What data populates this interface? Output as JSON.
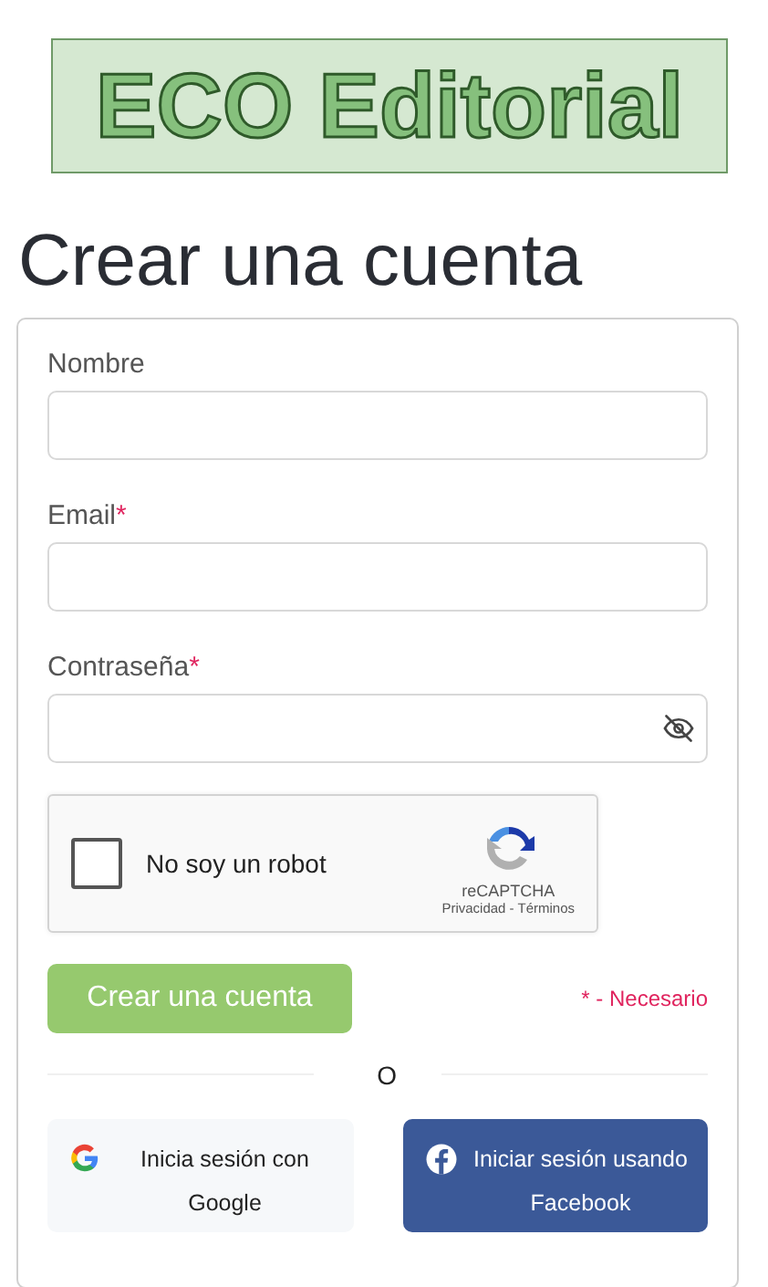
{
  "logo": {
    "text": "ECO Editorial"
  },
  "title": "Crear una cuenta",
  "fields": [
    {
      "label": "Nombre",
      "kind": "text"
    },
    {
      "label": "Email",
      "kind": "text",
      "required_mark": "*"
    },
    {
      "label": "Contraseña",
      "kind": "password",
      "required_mark": "*"
    }
  ],
  "captcha": {
    "checked": false,
    "label": "No soy un robot",
    "brand": "reCAPTCHA",
    "links": [
      "Privacidad",
      "Términos"
    ],
    "separator": "-"
  },
  "submit": {
    "label": "Crear una cuenta"
  },
  "required_note": "* - Necesario",
  "divider": "O",
  "social": [
    {
      "kind": "google",
      "label": "Inicia sesión con Google"
    },
    {
      "kind": "facebook",
      "label": "Iniciar sesión usando Facebook"
    }
  ]
}
